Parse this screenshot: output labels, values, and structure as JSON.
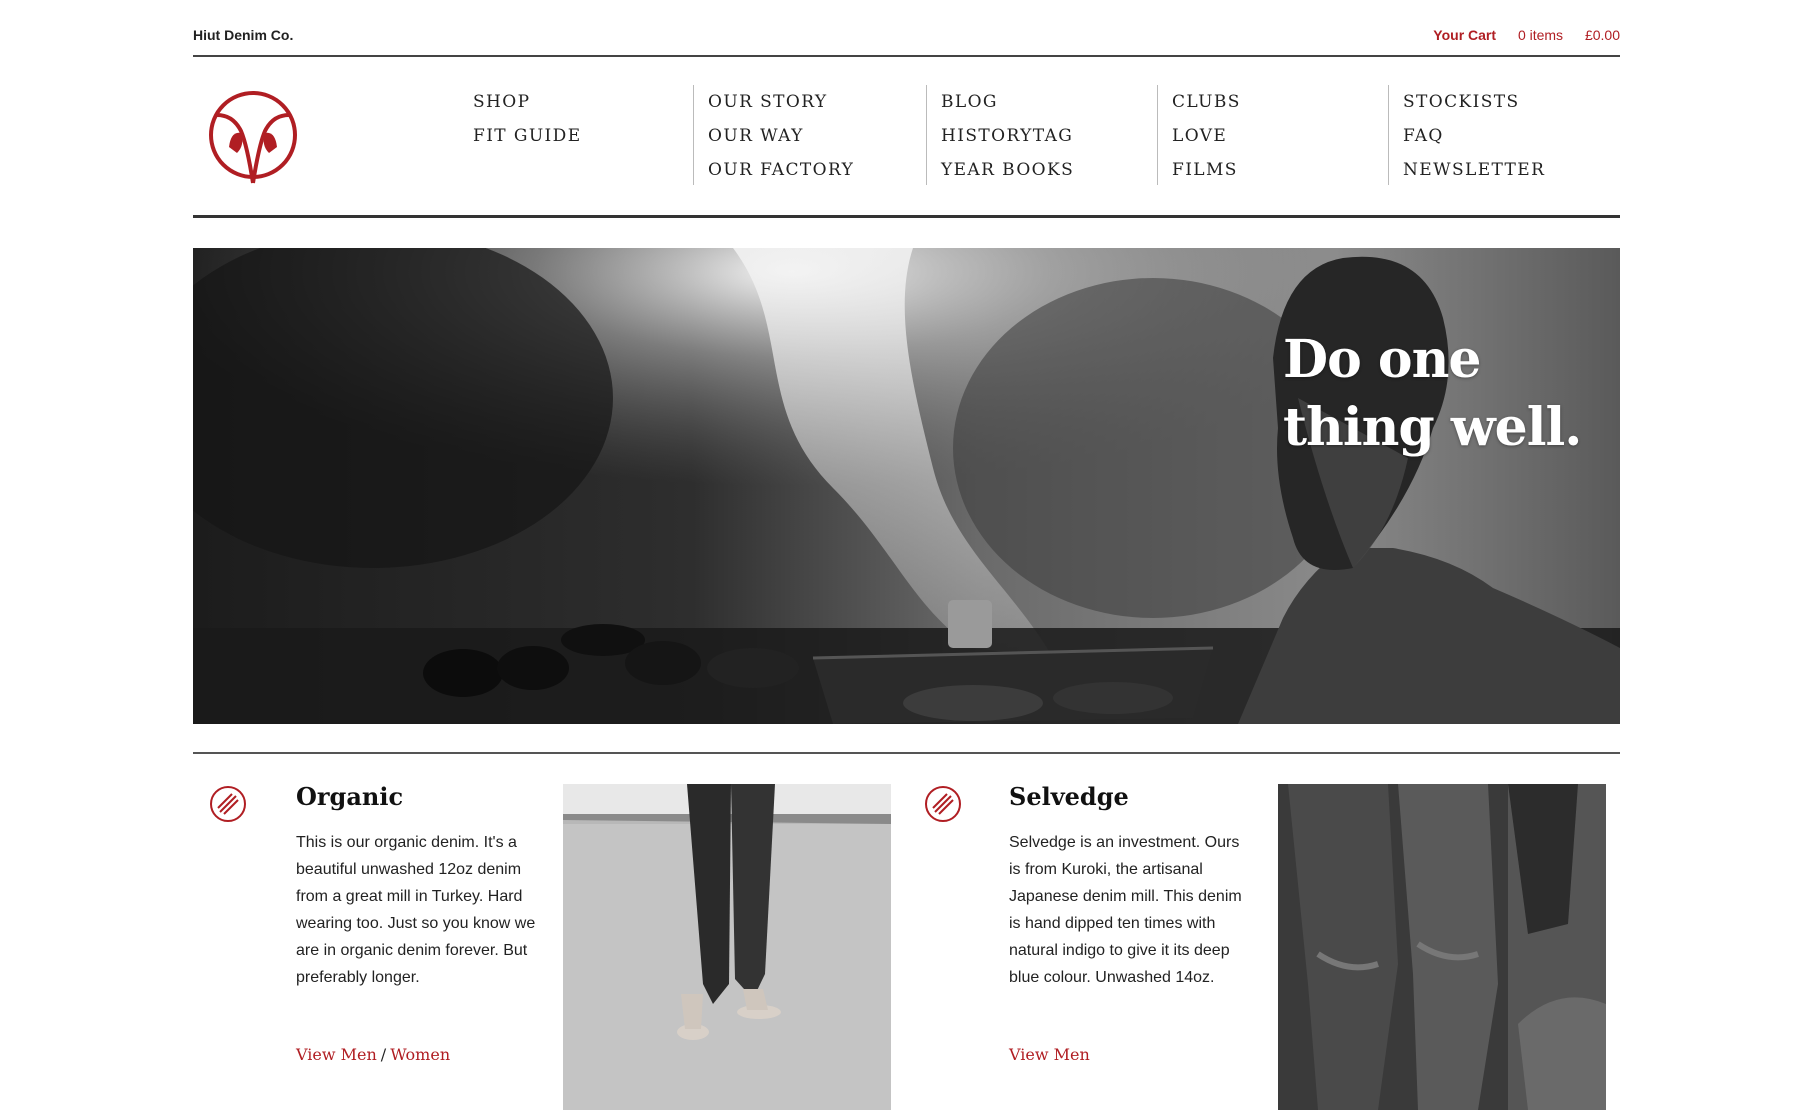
{
  "topbar": {
    "brand": "Hiut Denim Co.",
    "cart_label": "Your Cart",
    "cart_items": "0 items",
    "cart_total": "£0.00"
  },
  "nav": {
    "columns": [
      [
        "SHOP",
        "FIT GUIDE"
      ],
      [
        "OUR STORY",
        "OUR WAY",
        "OUR FACTORY"
      ],
      [
        "BLOG",
        "HISTORYTAG",
        "YEAR BOOKS"
      ],
      [
        "CLUBS",
        "LOVE",
        "FILMS"
      ],
      [
        "STOCKISTS",
        "FAQ",
        "NEWSLETTER"
      ]
    ]
  },
  "hero": {
    "headline_line1": "Do one",
    "headline_line2": "thing well."
  },
  "products": [
    {
      "title": "Organic",
      "description": "This is our organic denim. It's a beautiful unwashed 12oz denim from a great mill in Turkey. Hard wearing too. Just so you know we are in organic denim forever. But preferably longer.",
      "link_men": "View Men",
      "separator": "/",
      "link_women": "Women"
    },
    {
      "title": "Selvedge",
      "description": "Selvedge is an investment. Ours is from Kuroki, the artisanal Japanese denim mill. This denim is hand dipped ten times with natural indigo to give it its deep blue colour. Unwashed 14oz.",
      "link_men": "View Men"
    }
  ],
  "colors": {
    "accent": "#b01e23",
    "text": "#222222",
    "rule": "#333333"
  },
  "icons": {
    "logo": "owl-v-logo-icon",
    "product": "striped-circle-icon"
  }
}
